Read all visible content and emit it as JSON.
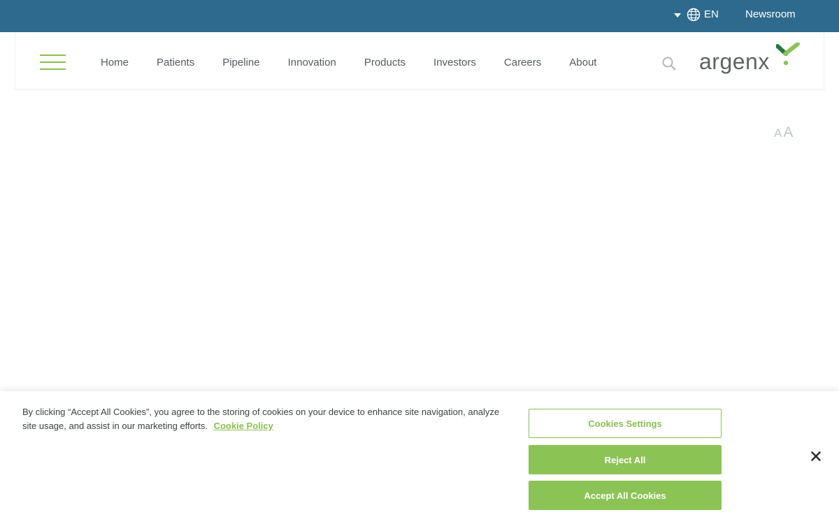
{
  "topbar": {
    "language": "EN",
    "newsroom_label": "Newsroom",
    "background_color": "#2e6a8e"
  },
  "header": {
    "nav_items": [
      "Home",
      "Patients",
      "Pipeline",
      "Innovation",
      "Products",
      "Investors",
      "Careers",
      "About"
    ],
    "logo_text": "argenx",
    "accent_color": "#8bbf4f"
  },
  "font_size_control": {
    "small": "A",
    "large": "A"
  },
  "icons": {
    "menu": "hamburger-icon",
    "language": "globe-icon",
    "search": "search-icon",
    "close": "close-icon"
  },
  "cookie_banner": {
    "text": "By clicking “Accept All Cookies”, you agree to the storing of cookies on your device to enhance site navigation, analyze site usage, and assist in our marketing efforts.",
    "policy_link": "Cookie Policy",
    "settings_label": "Cookies Settings",
    "reject_label": "Reject All",
    "accept_label": "Accept All Cookies"
  }
}
